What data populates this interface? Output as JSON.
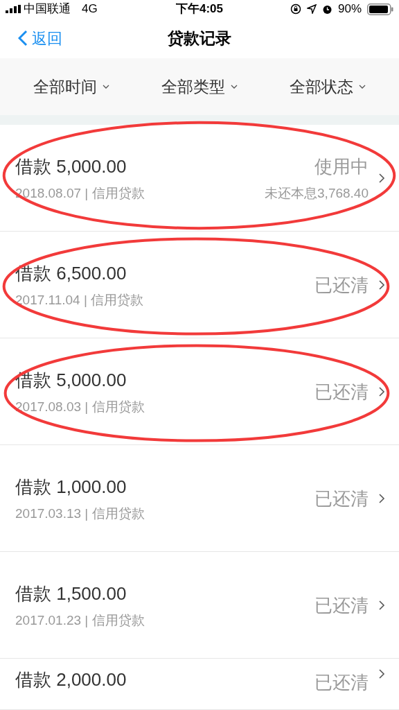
{
  "status_bar": {
    "carrier": "中国联通",
    "network": "4G",
    "time": "下午4:05",
    "battery": "90%"
  },
  "nav": {
    "back": "返回",
    "title": "贷款记录"
  },
  "filters": [
    {
      "label": "全部时间"
    },
    {
      "label": "全部类型"
    },
    {
      "label": "全部状态"
    }
  ],
  "loans": [
    {
      "amount": "借款 5,000.00",
      "meta": "2018.08.07 | 信用贷款",
      "status": "使用中",
      "remaining": "未还本息3,768.40",
      "circled": true
    },
    {
      "amount": "借款 6,500.00",
      "meta": "2017.11.04 | 信用贷款",
      "status": "已还清",
      "circled": true
    },
    {
      "amount": "借款 5,000.00",
      "meta": "2017.08.03 | 信用贷款",
      "status": "已还清",
      "circled": true
    },
    {
      "amount": "借款 1,000.00",
      "meta": "2017.03.13 | 信用贷款",
      "status": "已还清",
      "circled": false
    },
    {
      "amount": "借款 1,500.00",
      "meta": "2017.01.23 | 信用贷款",
      "status": "已还清",
      "circled": false
    },
    {
      "amount": "借款 2,000.00",
      "status": "已还清",
      "circled": false
    }
  ]
}
